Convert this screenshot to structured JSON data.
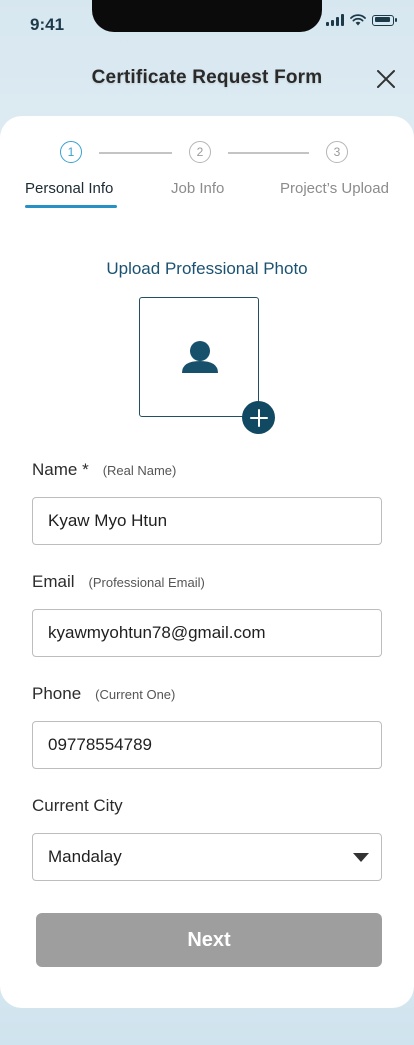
{
  "status_bar": {
    "time": "9:41"
  },
  "header": {
    "title": "Certificate Request Form"
  },
  "stepper": {
    "steps": [
      {
        "number": "1",
        "label": "Personal Info"
      },
      {
        "number": "2",
        "label": "Job Info"
      },
      {
        "number": "3",
        "label": "Project’s Upload"
      }
    ]
  },
  "photo": {
    "label": "Upload Professional Photo"
  },
  "form": {
    "name": {
      "label": "Name *",
      "hint": "(Real Name)",
      "value": "Kyaw Myo Htun"
    },
    "email": {
      "label": "Email",
      "hint": "(Professional Email)",
      "value": "kyawmyohtun78@gmail.com"
    },
    "phone": {
      "label": "Phone",
      "hint": "(Current One)",
      "value": "09778554789"
    },
    "city": {
      "label": "Current City",
      "value": "Mandalay"
    }
  },
  "actions": {
    "next_label": "Next"
  },
  "colors": {
    "accent": "#2790c4",
    "dark_teal": "#114962",
    "button_disabled": "#9e9e9e"
  }
}
